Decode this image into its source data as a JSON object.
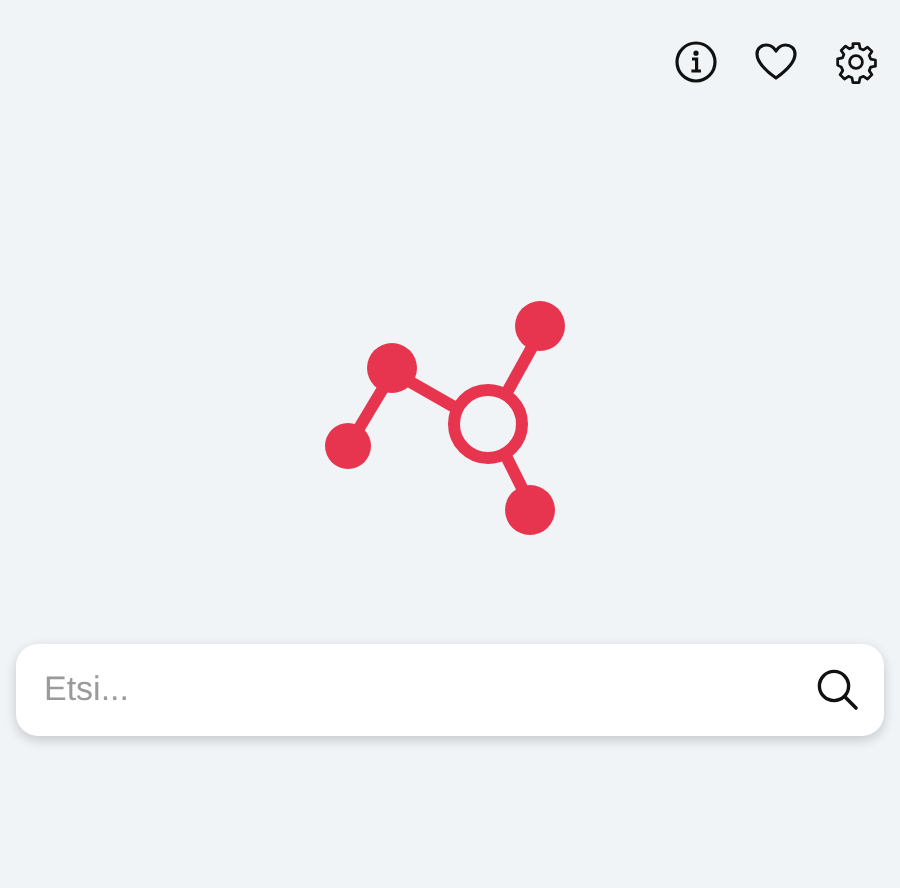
{
  "search": {
    "placeholder": "Etsi..."
  }
}
